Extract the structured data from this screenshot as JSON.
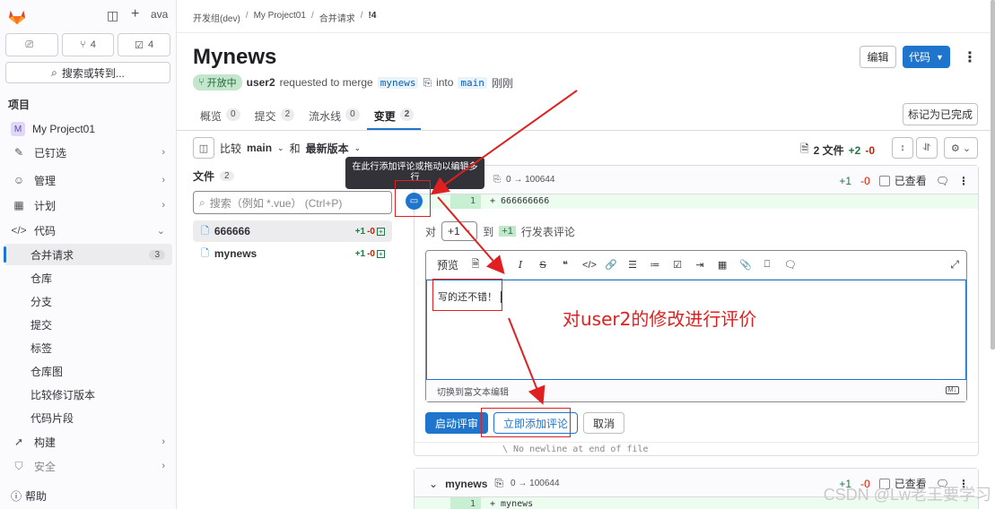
{
  "sidebar": {
    "user_short": "ava",
    "counts": [
      {
        "icon": "merge-request-icon",
        "value": ""
      },
      {
        "icon": "pull-icon",
        "value": "4"
      },
      {
        "icon": "todo-icon",
        "value": "4"
      }
    ],
    "search_label": "搜索或转到...",
    "section_title": "项目",
    "project_avatar": "M",
    "project_name": "My Project01",
    "items": [
      {
        "label": "已钉选"
      },
      {
        "label": "管理"
      },
      {
        "label": "计划"
      },
      {
        "label": "代码"
      }
    ],
    "code_sub": [
      {
        "label": "合并请求",
        "badge": "3"
      },
      {
        "label": "仓库"
      },
      {
        "label": "分支"
      },
      {
        "label": "提交"
      },
      {
        "label": "标签"
      },
      {
        "label": "仓库图"
      },
      {
        "label": "比较修订版本"
      },
      {
        "label": "代码片段"
      }
    ],
    "build": "构建",
    "security": "安全",
    "help": "帮助"
  },
  "breadcrumb": [
    "开发组(dev)",
    "My Project01",
    "合并请求",
    "!4"
  ],
  "title": "Mynews",
  "buttons": {
    "edit": "编辑",
    "code": "代码",
    "mark_done": "标记为已完成"
  },
  "meta": {
    "status": "开放中",
    "user": "user2",
    "requested": "requested to merge",
    "source_branch": "mynews",
    "into": "into",
    "target_branch": "main",
    "time": "刚刚"
  },
  "tabs": [
    {
      "label": "概览",
      "count": "0"
    },
    {
      "label": "提交",
      "count": "2"
    },
    {
      "label": "流水线",
      "count": "0"
    },
    {
      "label": "变更",
      "count": "2"
    }
  ],
  "compare": {
    "label": "比较",
    "from": "main",
    "and": "和",
    "to": "最新版本"
  },
  "file_stats": {
    "files": "2 文件",
    "added": "+2",
    "removed": "-0"
  },
  "files_panel": {
    "title": "文件",
    "count": "2",
    "search_placeholder": "搜索（例如 *.vue） (Ctrl+P)",
    "files": [
      {
        "name": "666666",
        "added": "+1",
        "removed": "-0"
      },
      {
        "name": "mynews",
        "added": "+1",
        "removed": "-0"
      }
    ]
  },
  "diff1": {
    "mode": "0 → 100644",
    "added": "+1",
    "removed": "-0",
    "viewed": "已查看",
    "line_no": "1",
    "code": "+  666666666",
    "comment_on": "对",
    "line_from": "+1",
    "to": "到",
    "line_to": "+1",
    "comment_suffix": "行发表评论",
    "toolbar_preview": "预览",
    "comment_text": "写的还不错！",
    "rich_text_toggle": "切换到富文本编辑",
    "md": "M↓",
    "btn_start_review": "启动评审",
    "btn_add_now": "立即添加评论",
    "btn_cancel": "取消",
    "no_newline": "\\ No newline at end of file"
  },
  "diff2": {
    "name": "mynews",
    "mode": "0 → 100644",
    "added": "+1",
    "removed": "-0",
    "viewed": "已查看",
    "line_no": "1",
    "code": "+  mynews"
  },
  "tooltip": "在此行添加评论或拖动以编辑多行",
  "annotation": "对user2的修改进行评价",
  "watermark": "CSDN @Lw老王要学习"
}
